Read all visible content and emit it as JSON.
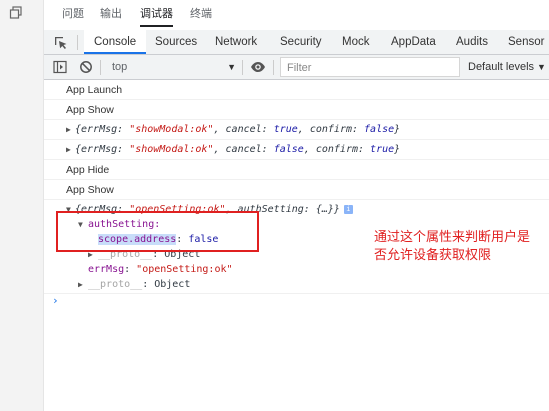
{
  "top_tabs": [
    {
      "label": "问题"
    },
    {
      "label": "输出"
    },
    {
      "label": "调试器"
    },
    {
      "label": "终端"
    }
  ],
  "devtools_tabs": [
    {
      "label": "Console"
    },
    {
      "label": "Sources"
    },
    {
      "label": "Network"
    },
    {
      "label": "Security"
    },
    {
      "label": "Mock"
    },
    {
      "label": "AppData"
    },
    {
      "label": "Audits"
    },
    {
      "label": "Sensor"
    }
  ],
  "toolbar": {
    "context": "top",
    "filter_placeholder": "Filter",
    "levels": "Default levels"
  },
  "logs": {
    "app_launch": "App Launch",
    "app_show_1": "App Show",
    "app_hide": "App Hide",
    "app_show_2": "App Show",
    "modal_1": {
      "k1": "{errMsg: ",
      "v1": "\"showModal:ok\"",
      "k2": ", cancel: ",
      "v2": "true",
      "k3": ", confirm: ",
      "v3": "false",
      "end": "}"
    },
    "modal_2": {
      "k1": "{errMsg: ",
      "v1": "\"showModal:ok\"",
      "k2": ", cancel: ",
      "v2": "false",
      "k3": ", confirm: ",
      "v3": "true",
      "end": "}"
    },
    "setting": {
      "k1": "{errMsg: ",
      "v1": "\"openSetting:ok\"",
      "k2": ", authSetting: {…}}",
      "info": "i",
      "auth_key": "authSetting:",
      "scope_key": "scope.address",
      "scope_sep": ": ",
      "scope_val": "false",
      "proto_1_key": "__proto__",
      "proto_1_val": ": Object",
      "errmsg_key": "errMsg",
      "errmsg_sep": ": ",
      "errmsg_val": "\"openSetting:ok\"",
      "proto_2_key": "__proto__",
      "proto_2_val": ": Object"
    },
    "prompt": "›"
  },
  "annotation": {
    "text": "通过这个属性来判断用户是否允许设备获取权限"
  },
  "icons": [
    "restore-window-icon",
    "inspect-element-icon",
    "sidebar-toggle-icon",
    "clear-console-icon",
    "eye-icon",
    "dropdown-arrow-icon"
  ]
}
